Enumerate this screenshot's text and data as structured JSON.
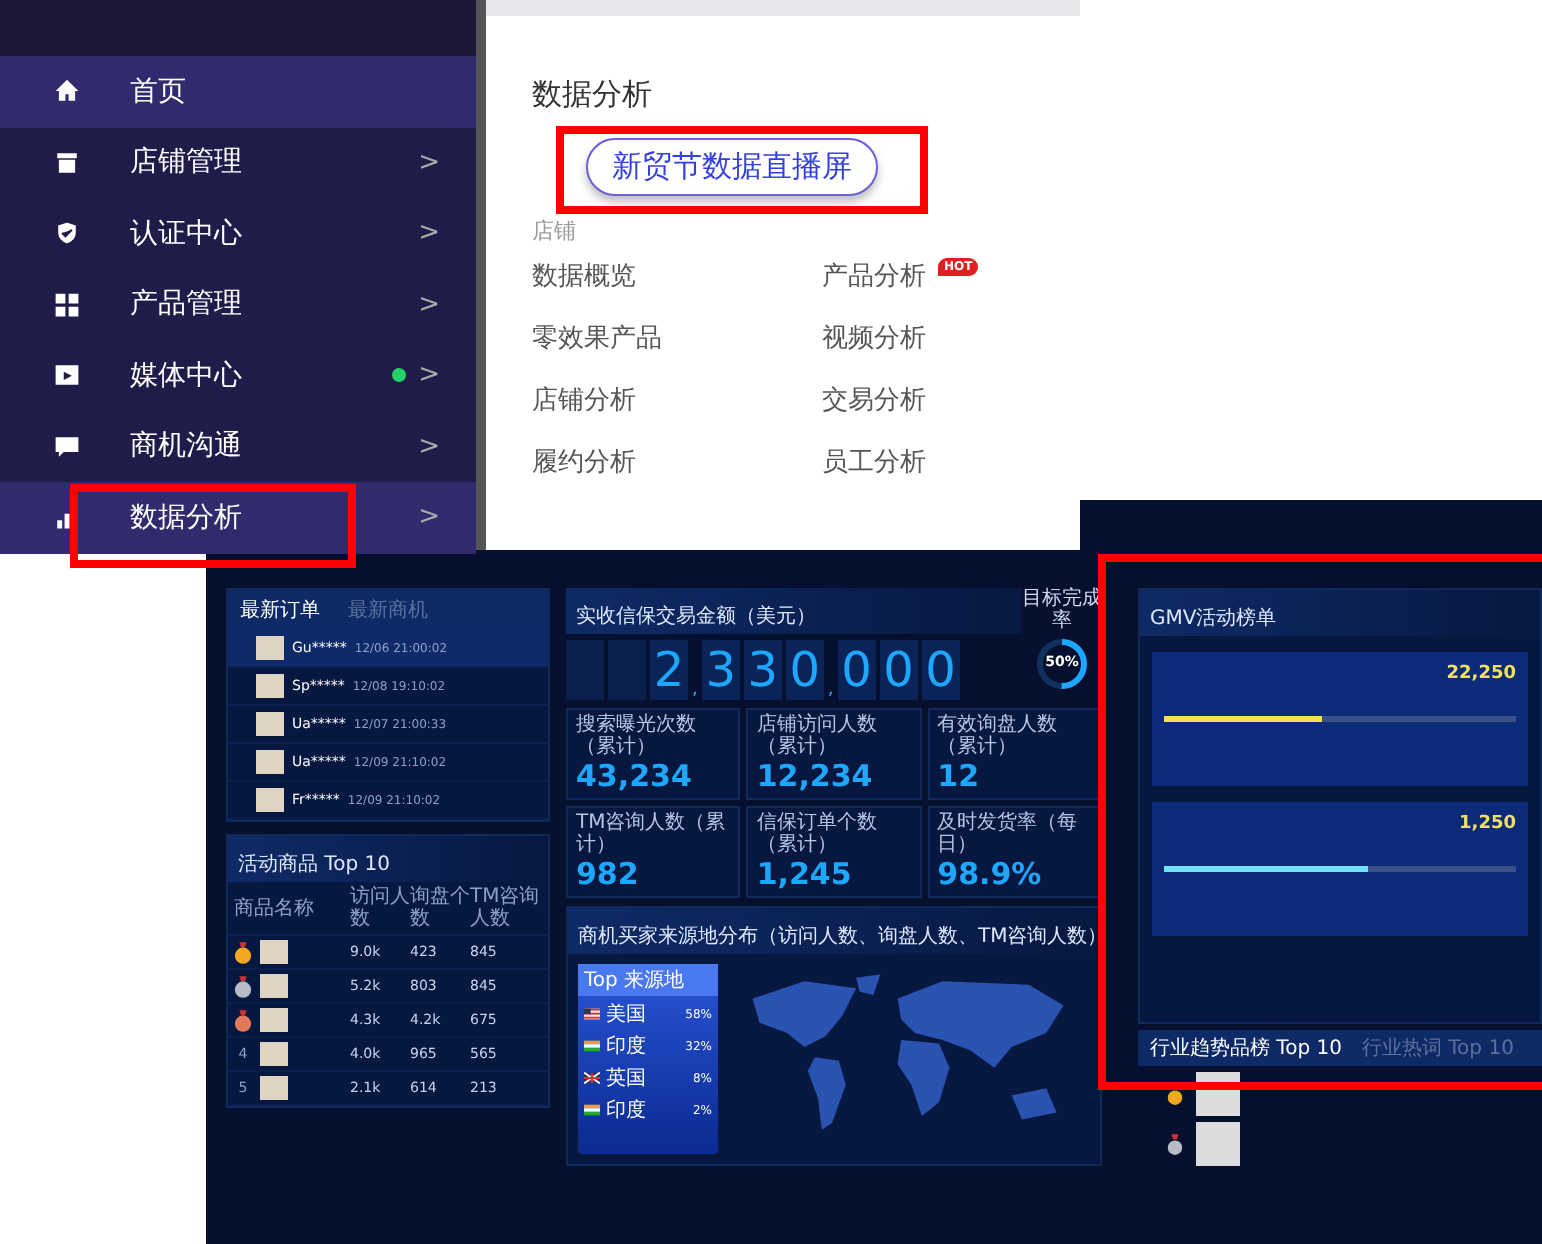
{
  "sidebar": {
    "items": [
      {
        "label": "首页",
        "selected": true,
        "expanded": false,
        "has_dot": false
      },
      {
        "label": "店铺管理",
        "arrow": ">",
        "selected": false,
        "expanded": false,
        "has_dot": false
      },
      {
        "label": "认证中心",
        "arrow": ">",
        "selected": false,
        "expanded": false,
        "has_dot": false
      },
      {
        "label": "产品管理",
        "arrow": ">",
        "selected": false,
        "expanded": false,
        "has_dot": false
      },
      {
        "label": "媒体中心",
        "arrow": ">",
        "selected": false,
        "expanded": false,
        "has_dot": true
      },
      {
        "label": "商机沟通",
        "arrow": ">",
        "selected": false,
        "expanded": false,
        "has_dot": false
      },
      {
        "label": "数据分析",
        "arrow": ">",
        "selected": false,
        "expanded": true,
        "has_dot": false
      }
    ]
  },
  "menu_panel": {
    "title": "数据分析",
    "live_button": "新贸节数据直播屏",
    "section": "店铺",
    "links": [
      {
        "label": "数据概览"
      },
      {
        "label": "产品分析",
        "badge": "HOT"
      },
      {
        "label": "零效果产品"
      },
      {
        "label": "视频分析"
      },
      {
        "label": "店铺分析"
      },
      {
        "label": "交易分析"
      },
      {
        "label": "履约分析"
      },
      {
        "label": "员工分析"
      }
    ]
  },
  "dashboard": {
    "orders": {
      "tabs": [
        {
          "label": "最新订单",
          "selected": true
        },
        {
          "label": "最新商机",
          "selected": false
        }
      ],
      "rows": [
        {
          "buyer": "Gu*****",
          "time": "12/06 21:00:02",
          "selected": true
        },
        {
          "buyer": "Sp*****",
          "time": "12/08 19:10:02",
          "selected": false
        },
        {
          "buyer": "Ua*****",
          "time": "12/07 21:00:33",
          "selected": false
        },
        {
          "buyer": "Ua*****",
          "time": "12/09 21:10:02",
          "selected": false
        },
        {
          "buyer": "Fr*****",
          "time": "12/09 21:10:02",
          "selected": false
        }
      ]
    },
    "amount": {
      "title": "实收信保交易金额（美元）",
      "value": "2,330,000",
      "target_label": "目标完成率",
      "target": "50%",
      "level": 0.5
    },
    "stats": [
      {
        "label": "搜索曝光次数（累计）",
        "value": "43,234"
      },
      {
        "label": "店铺访问人数（累计）",
        "value": "12,234"
      },
      {
        "label": "有效询盘人数（累计）",
        "value": "12"
      },
      {
        "label": "TM咨询人数（累计）",
        "value": "982"
      },
      {
        "label": "信保订单个数（累计）",
        "value": "1,245"
      },
      {
        "label": "及时发货率（每日）",
        "value": "98.9%"
      }
    ],
    "top10": {
      "title": "活动商品 Top 10",
      "columns": [
        "商品名称",
        "访问人数",
        "询盘个数",
        "TM咨询人数"
      ],
      "rows": [
        {
          "kind": "medal",
          "color": "#f0a820",
          "visits": "9.0k",
          "inquiries": "423",
          "tm": "845"
        },
        {
          "kind": "medal",
          "color": "#b8bcc8",
          "visits": "5.2k",
          "inquiries": "803",
          "tm": "845"
        },
        {
          "kind": "medal",
          "color": "#e07a5a",
          "visits": "4.3k",
          "inquiries": "4.2k",
          "tm": "675"
        },
        {
          "kind": "number",
          "rank": "4",
          "visits": "4.0k",
          "inquiries": "965",
          "tm": "565"
        },
        {
          "kind": "number",
          "rank": "5",
          "visits": "2.1k",
          "inquiries": "614",
          "tm": "213"
        }
      ]
    },
    "map": {
      "title": "商机买家来源地分布（访问人数、询盘人数、TM咨询人数）",
      "list_title": "Top 来源地",
      "sources": [
        {
          "kind": "us",
          "country": "美国",
          "share": "58%"
        },
        {
          "kind": "in",
          "country": "印度",
          "share": "32%"
        },
        {
          "kind": "uk",
          "country": "英国",
          "share": "8%"
        },
        {
          "kind": "in",
          "country": "印度",
          "share": "2%"
        }
      ]
    },
    "gmv": {
      "title": "GMV活动榜单",
      "groups": [
        {
          "value": "22,250",
          "color": "#f5e050",
          "level": 0.45
        },
        {
          "value": "1,250",
          "color": "#6fe3f5",
          "level": 0.58
        }
      ]
    },
    "trend_tabs": [
      {
        "label": "行业趋势品榜 Top 10",
        "selected": true
      },
      {
        "label": "行业热词 Top 10",
        "selected": false
      }
    ],
    "trend_items": [
      {
        "color": "#f0a820"
      },
      {
        "color": "#b8bcc8"
      }
    ]
  }
}
